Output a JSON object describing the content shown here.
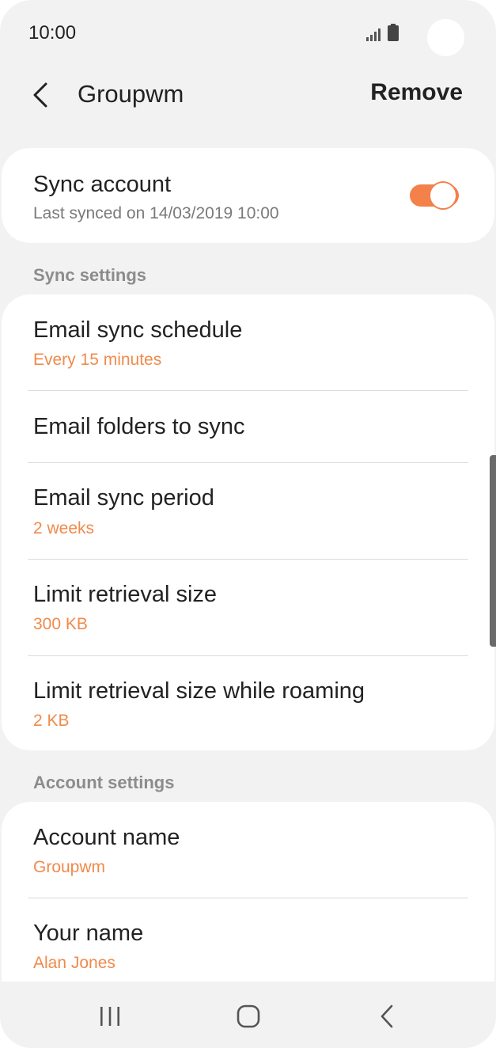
{
  "status_bar": {
    "time": "10:00",
    "icons": [
      "signal-icon",
      "battery-icon"
    ]
  },
  "header": {
    "title": "Groupwm",
    "remove_label": "Remove",
    "back_icon": "chevron-left-icon"
  },
  "sync_account": {
    "title": "Sync account",
    "last_synced": "Last synced on 14/03/2019  10:00",
    "toggle_on": true
  },
  "sync_settings": {
    "section_title": "Sync settings",
    "items": [
      {
        "title": "Email sync schedule",
        "value": "Every 15 minutes"
      },
      {
        "title": "Email folders to sync",
        "value": ""
      },
      {
        "title": "Email sync period",
        "value": "2 weeks"
      },
      {
        "title": "Limit retrieval size",
        "value": "300 KB"
      },
      {
        "title": "Limit retrieval size while roaming",
        "value": "2 KB"
      }
    ]
  },
  "account_settings": {
    "section_title": "Account settings",
    "items": [
      {
        "title": "Account name",
        "value": "Groupwm"
      },
      {
        "title": "Your name",
        "value": "Alan Jones"
      }
    ]
  },
  "nav_bar": {
    "icons": [
      "recent-apps-icon",
      "home-icon",
      "back-icon"
    ]
  },
  "colors": {
    "accent": "#f4804a",
    "value_text": "#f08a4b",
    "background": "#f2f2f2",
    "card": "#ffffff"
  }
}
